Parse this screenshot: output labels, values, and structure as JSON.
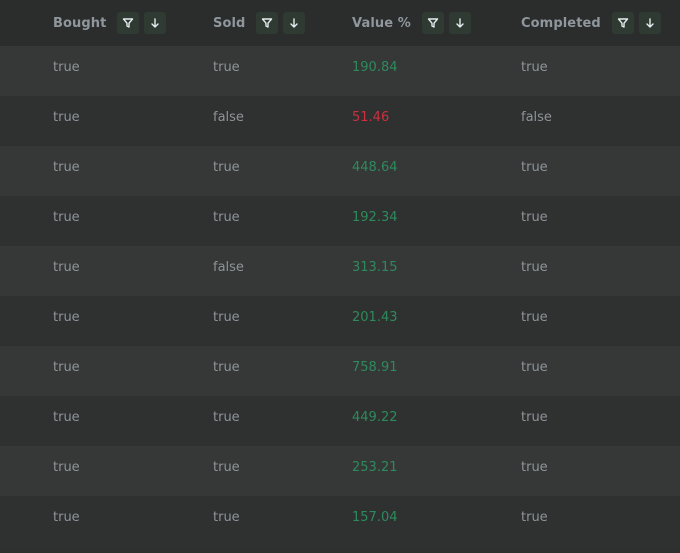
{
  "columns": [
    {
      "label": "Bought"
    },
    {
      "label": "Sold"
    },
    {
      "label": "Value %"
    },
    {
      "label": "Completed"
    }
  ],
  "icons": {
    "filter": "filter-icon",
    "sort": "arrow-down-icon"
  },
  "colors": {
    "positive": "#2e8a5c",
    "negative": "#cc3040",
    "accent_button": "#2f3a33"
  },
  "rows": [
    {
      "bought": "true",
      "sold": "true",
      "value": "190.84",
      "value_sign": "positive",
      "completed": "true"
    },
    {
      "bought": "true",
      "sold": "false",
      "value": "51.46",
      "value_sign": "negative",
      "completed": "false"
    },
    {
      "bought": "true",
      "sold": "true",
      "value": "448.64",
      "value_sign": "positive",
      "completed": "true"
    },
    {
      "bought": "true",
      "sold": "true",
      "value": "192.34",
      "value_sign": "positive",
      "completed": "true"
    },
    {
      "bought": "true",
      "sold": "false",
      "value": "313.15",
      "value_sign": "positive",
      "completed": "true"
    },
    {
      "bought": "true",
      "sold": "true",
      "value": "201.43",
      "value_sign": "positive",
      "completed": "true"
    },
    {
      "bought": "true",
      "sold": "true",
      "value": "758.91",
      "value_sign": "positive",
      "completed": "true"
    },
    {
      "bought": "true",
      "sold": "true",
      "value": "449.22",
      "value_sign": "positive",
      "completed": "true"
    },
    {
      "bought": "true",
      "sold": "true",
      "value": "253.21",
      "value_sign": "positive",
      "completed": "true"
    },
    {
      "bought": "true",
      "sold": "true",
      "value": "157.04",
      "value_sign": "positive",
      "completed": "true"
    }
  ]
}
